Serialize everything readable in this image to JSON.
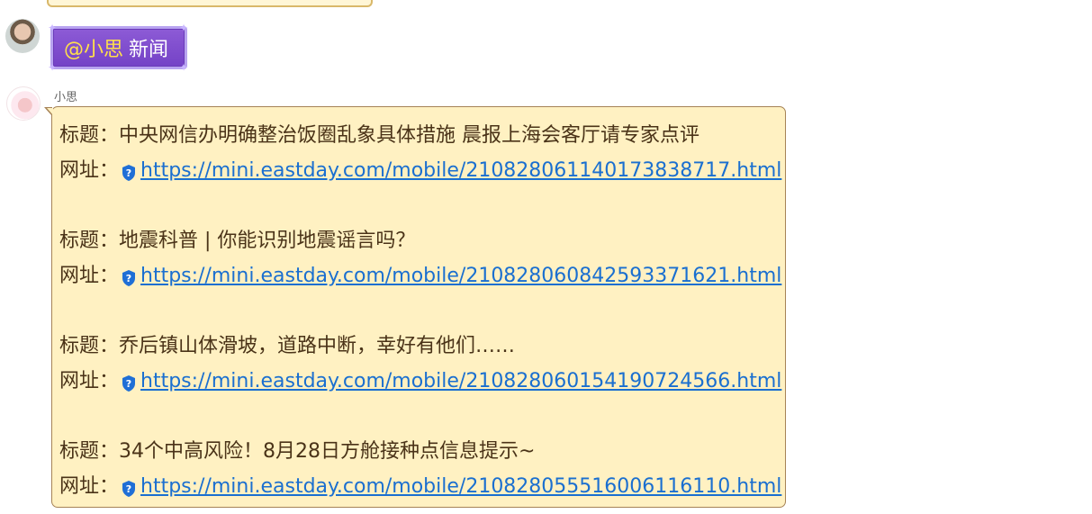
{
  "command_message": {
    "mention": "@小思",
    "text": "新闻"
  },
  "bot_message": {
    "sender": "小思",
    "title_label": "标题：",
    "url_label": "网址：",
    "items": [
      {
        "title": "中央网信办明确整治饭圈乱象具体措施 晨报上海会客厅请专家点评",
        "url": "https://mini.eastday.com/mobile/210828061140173838717.html"
      },
      {
        "title": "地震科普 | 你能识别地震谣言吗？",
        "url": "https://mini.eastday.com/mobile/210828060842593371621.html"
      },
      {
        "title": "乔后镇山体滑坡，道路中断，幸好有他们……",
        "url": "https://mini.eastday.com/mobile/210828060154190724566.html"
      },
      {
        "title": "34个中高风险！8月28日方舱接种点信息提示~",
        "url": "https://mini.eastday.com/mobile/210828055516006116110.html"
      }
    ]
  },
  "colors": {
    "bubble_bg": "#fff1c2",
    "bubble_border": "#a68356",
    "link": "#1a6fd0",
    "command_bg": "#7f4fce",
    "mention": "#ffe04a"
  },
  "icons": {
    "link_shield": "shield-question-icon"
  }
}
